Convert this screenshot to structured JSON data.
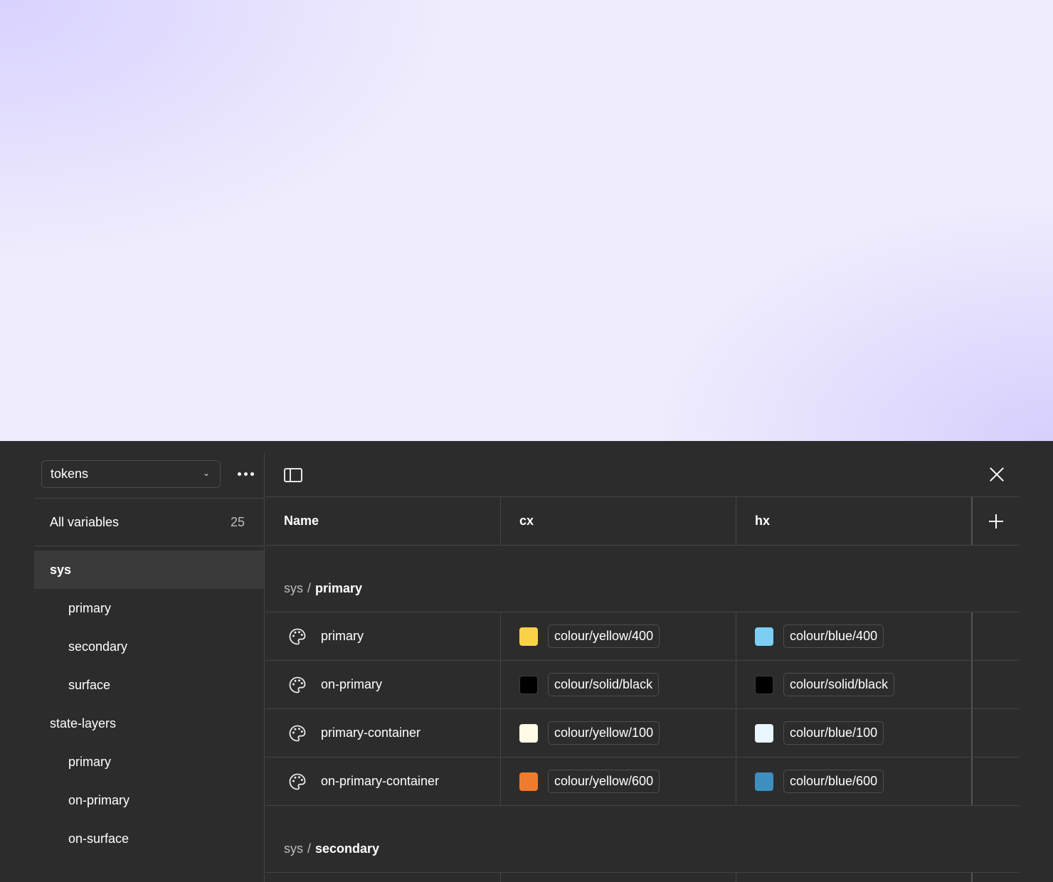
{
  "sidebar": {
    "collection": "tokens",
    "all_variables_label": "All variables",
    "all_variables_count": "25",
    "groups": [
      {
        "label": "sys",
        "level": 0,
        "active": true
      },
      {
        "label": "primary",
        "level": 1
      },
      {
        "label": "secondary",
        "level": 1
      },
      {
        "label": "surface",
        "level": 1
      },
      {
        "label": "state-layers",
        "level": 0
      },
      {
        "label": "primary",
        "level": 1
      },
      {
        "label": "on-primary",
        "level": 1
      },
      {
        "label": "on-surface",
        "level": 1
      }
    ]
  },
  "table": {
    "columns": {
      "name": "Name",
      "cx": "cx",
      "hx": "hx"
    },
    "sections": [
      {
        "parent": "sys",
        "separator": "/",
        "child": "primary",
        "rows": [
          {
            "name": "primary",
            "cx": {
              "alias": "colour/yellow/400",
              "color": "#f9d24a"
            },
            "hx": {
              "alias": "colour/blue/400",
              "color": "#7ccff3"
            }
          },
          {
            "name": "on-primary",
            "cx": {
              "alias": "colour/solid/black",
              "color": "#000000"
            },
            "hx": {
              "alias": "colour/solid/black",
              "color": "#000000"
            }
          },
          {
            "name": "primary-container",
            "cx": {
              "alias": "colour/yellow/100",
              "color": "#fffbe6"
            },
            "hx": {
              "alias": "colour/blue/100",
              "color": "#eaf6fd"
            }
          },
          {
            "name": "on-primary-container",
            "cx": {
              "alias": "colour/yellow/600",
              "color": "#ee7c2e"
            },
            "hx": {
              "alias": "colour/blue/600",
              "color": "#3d8fc0"
            }
          }
        ]
      },
      {
        "parent": "sys",
        "separator": "/",
        "child": "secondary",
        "rows": []
      }
    ]
  }
}
